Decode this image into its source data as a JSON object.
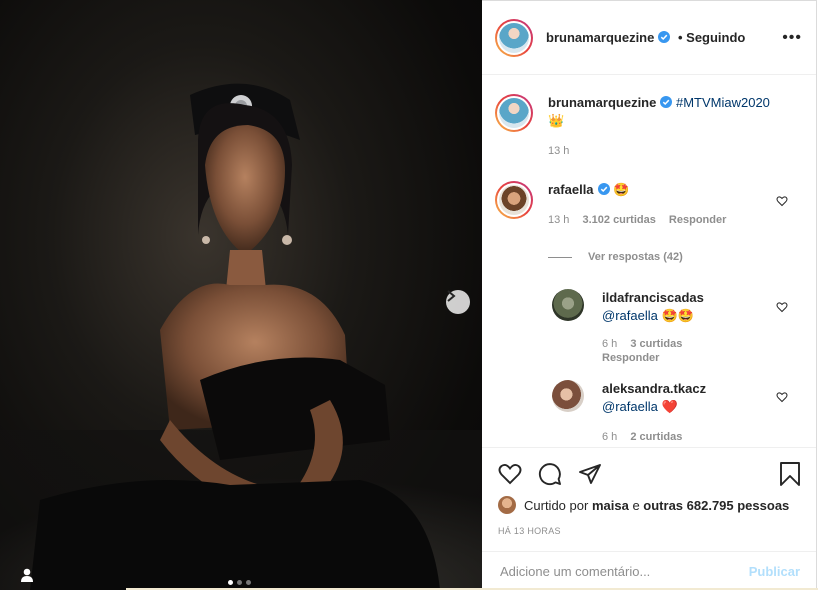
{
  "post": {
    "author": "brunamarquezine",
    "follow_status": "• Seguindo",
    "more_label": "•••",
    "carousel": {
      "count": 3,
      "active": 0
    }
  },
  "caption": {
    "username": "brunamarquezine",
    "text": "#MTVMiaw2020",
    "emoji": "👑",
    "time": "13 h"
  },
  "comments": [
    {
      "username": "rafaella",
      "text": "🤩",
      "time": "13 h",
      "likes": "3.102 curtidas",
      "reply": "Responder",
      "view_replies": "Ver respostas (42)"
    }
  ],
  "replies": [
    {
      "username": "ildafranciscadas",
      "mention": "@rafaella",
      "text": "🤩🤩",
      "time": "6 h",
      "likes": "3 curtidas",
      "reply": "Responder"
    },
    {
      "username": "aleksandra.tkacz",
      "mention": "@rafaella",
      "text": "❤️",
      "time": "6 h",
      "likes": "2 curtidas"
    }
  ],
  "likes": {
    "prefix": "Curtido por",
    "user": "maisa",
    "joiner": "e",
    "others": "outras 682.795 pessoas"
  },
  "timestamp": "HÁ 13 HORAS",
  "add_comment": {
    "placeholder": "Adicione um comentário...",
    "publish_label": "Publicar"
  },
  "colors": {
    "verified": "#3897f0",
    "link": "#00376b",
    "heart": "#ed4956",
    "publish_disabled": "#b2dffc"
  }
}
